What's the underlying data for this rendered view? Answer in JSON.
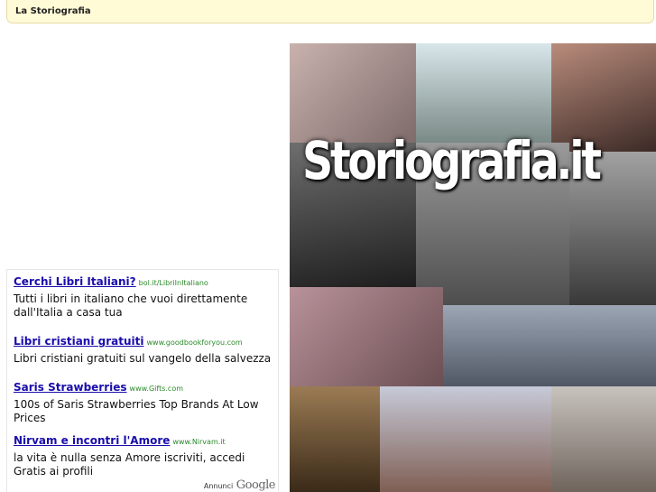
{
  "header": {
    "title": "La Storiografia"
  },
  "ads": [
    {
      "title": "Cerchi Libri Italiani?",
      "url": "bol.it/LibriInItaliano",
      "description": "Tutti i libri in italiano che vuoi direttamente dall'Italia a casa tua"
    },
    {
      "title": "Libri cristiani gratuiti",
      "url": "www.goodbookforyou.com",
      "description": "Libri cristiani gratuiti sul vangelo della salvezza"
    },
    {
      "title": "Saris Strawberries",
      "url": "www.Gifts.com",
      "description": "100s of Saris Strawberries Top Brands At Low Prices"
    },
    {
      "title": "Nirvam e incontri l'Amore",
      "url": "www.Nirvam.it",
      "description": "la vita è nulla senza Amore iscriviti, accedi Gratis ai profili"
    }
  ],
  "ads_footer": {
    "annunci": "Annunci",
    "google": "Google"
  },
  "hero": {
    "title": "Storiografia.it"
  }
}
